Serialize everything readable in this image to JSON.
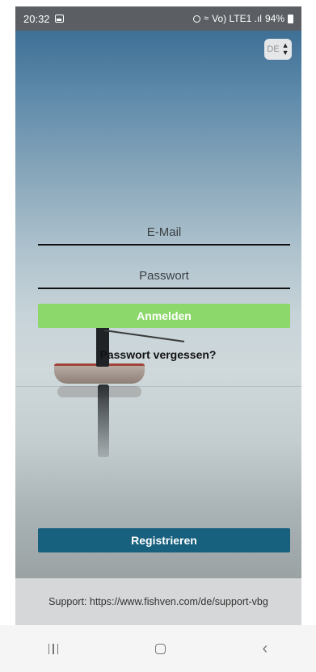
{
  "status_bar": {
    "time": "20:32",
    "signal_text": "Vo) LTE1 .ıl",
    "battery_percent": "94%"
  },
  "language_selector": {
    "selected": "DE"
  },
  "form": {
    "email_placeholder": "E-Mail",
    "password_placeholder": "Passwort",
    "login_label": "Anmelden",
    "forgot_password_label": "Passwort vergessen?",
    "register_label": "Registrieren"
  },
  "support": {
    "text": "Support: https://www.fishven.com/de/support-vbg"
  },
  "colors": {
    "login_button": "#8cd86a",
    "register_button": "#17607e",
    "status_bar": "#5b5f64"
  },
  "icons": {
    "status_left": "gallery-icon",
    "status_right": [
      "alarm-icon",
      "wifi-icon",
      "signal-icon",
      "battery-icon"
    ],
    "nav": [
      "recent-apps-icon",
      "home-icon",
      "back-icon"
    ],
    "language_caret": "sort-caret-icon"
  }
}
